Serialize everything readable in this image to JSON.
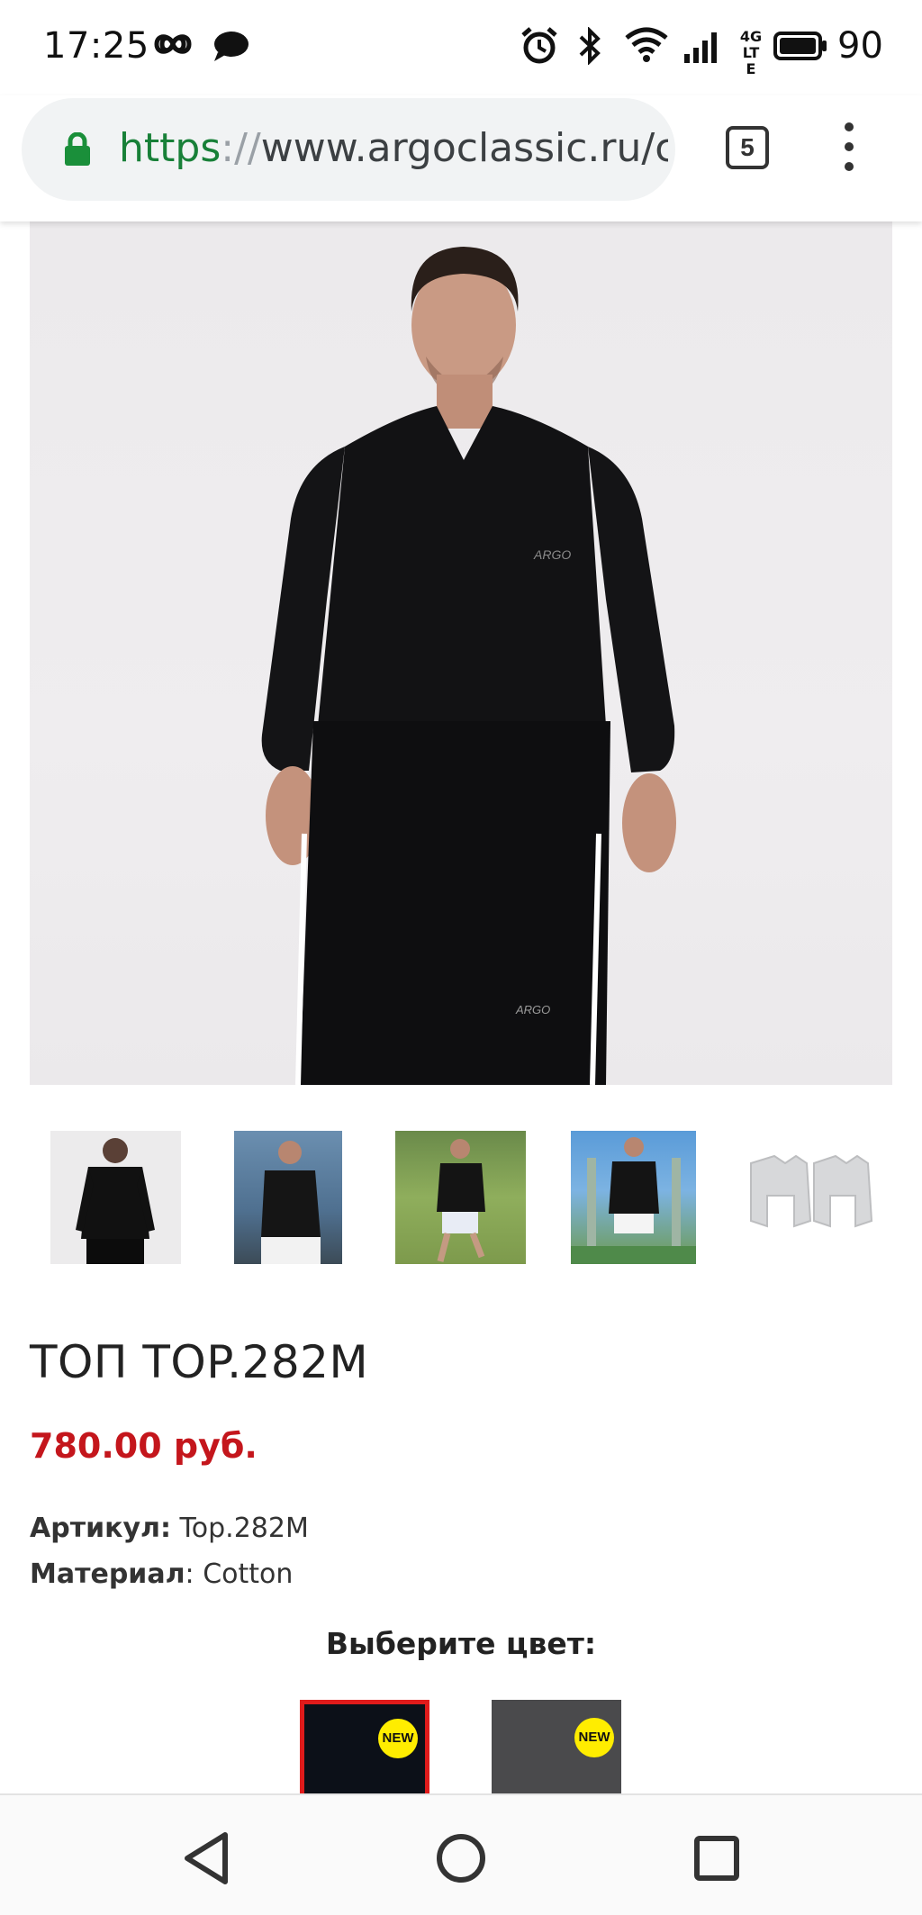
{
  "status_bar": {
    "time": "17:25",
    "battery_level": "90",
    "network_type": "4G LTE",
    "icons": [
      "infinity-icon",
      "chat-bubble-icon",
      "alarm-icon",
      "bluetooth-icon",
      "wifi-icon",
      "signal-icon",
      "battery-icon"
    ]
  },
  "browser": {
    "url_scheme": "https",
    "url_separator": "://",
    "url_host": "www.argoclassic.ru/c",
    "tab_count": "5",
    "lock_color": "#1a8f3a"
  },
  "product": {
    "title": "ТОП TOP.282M",
    "price": "780.00 руб.",
    "article_label": "Артикул:",
    "article_value": "Top.282M",
    "material_label": "Материал",
    "material_value": ": Cotton",
    "price_color": "#c4161c"
  },
  "gallery": {
    "thumbnails": [
      "back-view",
      "outdoor-pose",
      "running-in-park",
      "outdoor-exercise",
      "grey-shirts"
    ]
  },
  "color_select": {
    "heading": "Выберите цвет:",
    "swatches": [
      {
        "name": "black",
        "color": "#0c1018",
        "badge": "NEW",
        "selected": true
      },
      {
        "name": "grey",
        "color": "#4a4a4c",
        "badge": "NEW",
        "selected": false
      }
    ],
    "selected_border_color": "#e01b1b"
  }
}
